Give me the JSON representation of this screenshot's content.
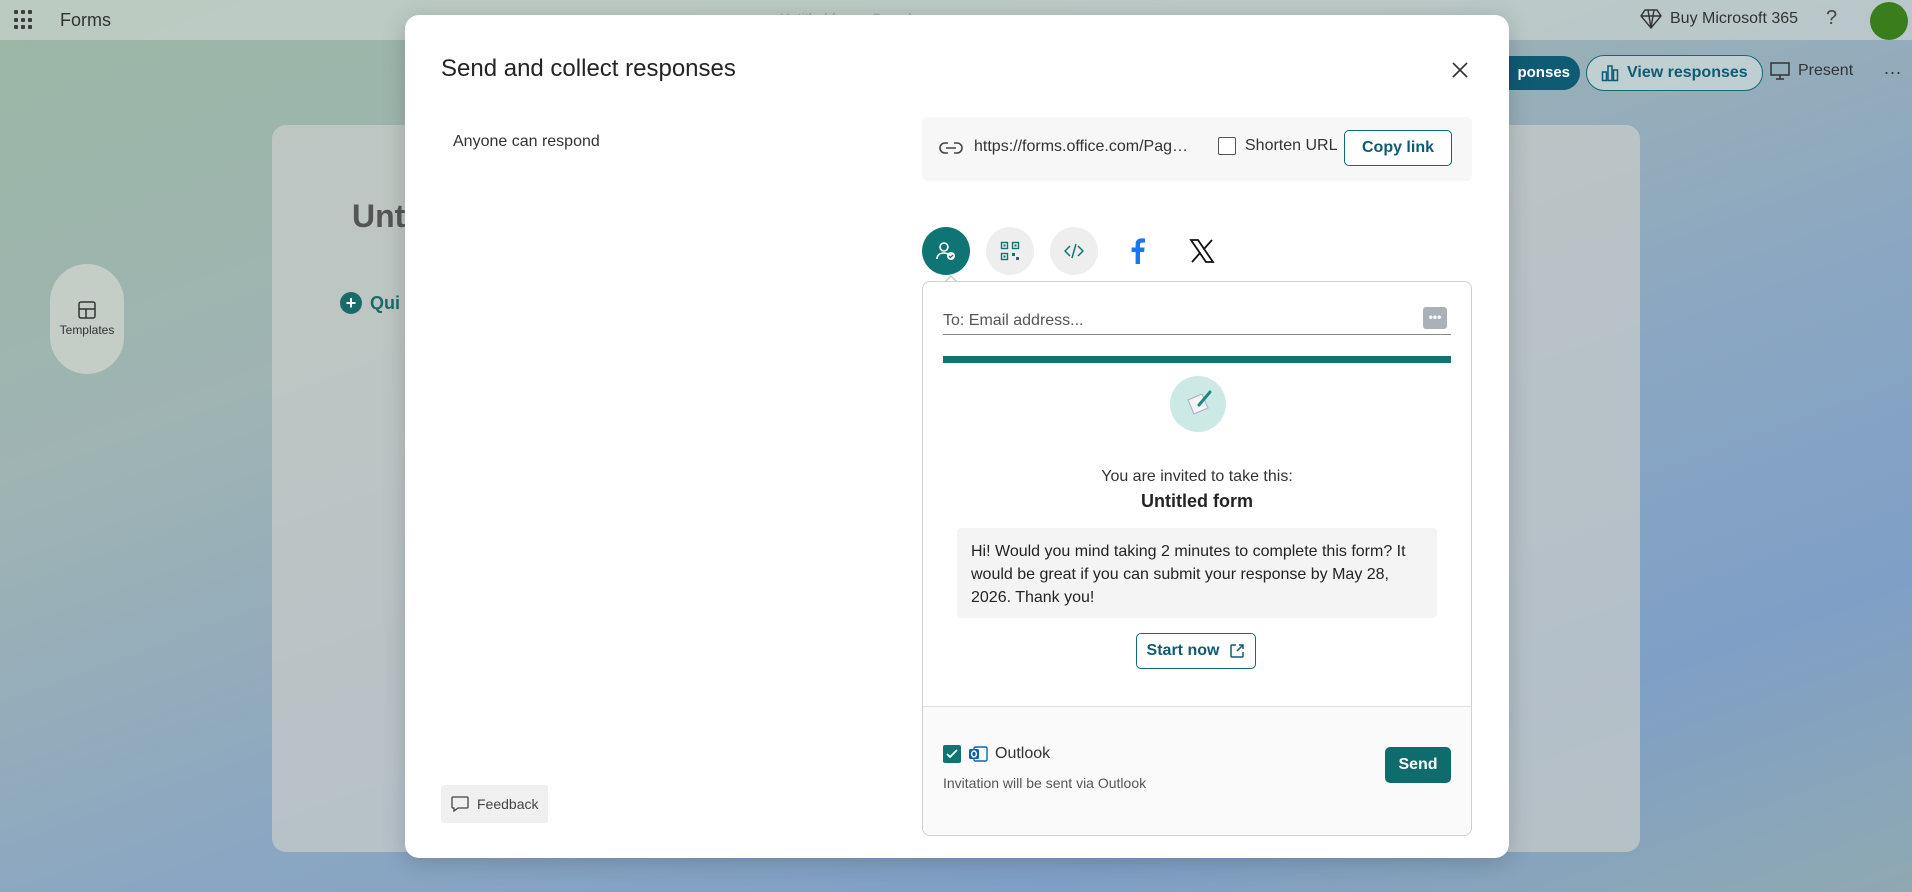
{
  "app": {
    "name": "Forms",
    "doc_title": "Untitled form - Saved",
    "buy_label": "Buy Microsoft 365",
    "help_label": "?"
  },
  "toolbar": {
    "collect_responses_label": "ponses",
    "view_responses_label": "View responses",
    "present_label": "Present",
    "more_label": "..."
  },
  "background": {
    "form_title_partial": "Unt",
    "quick_start_partial": "Qui",
    "templates_label": "Templates"
  },
  "modal": {
    "title": "Send and collect responses",
    "permission_label": "Anyone can respond",
    "link": {
      "url": "https://forms.office.com/Pages/ResponsePage.aspx",
      "shorten_label": "Shorten URL",
      "copy_label": "Copy link"
    },
    "share_options": [
      {
        "name": "invite-icon",
        "active": true
      },
      {
        "name": "qr-code-icon",
        "active": false
      },
      {
        "name": "embed-code-icon",
        "active": false
      },
      {
        "name": "facebook-icon",
        "active": false
      },
      {
        "name": "x-icon",
        "active": false
      }
    ],
    "email": {
      "placeholder": "To: Email address...",
      "more_label": "•••",
      "invited_text": "You are invited to take this:",
      "form_title": "Untitled form",
      "message": "Hi! Would you mind taking 2 minutes to complete this form? It would be great if you can submit your response by May 28, 2026. Thank you!",
      "start_label": "Start now",
      "outlook_label": "Outlook",
      "outlook_note": "Invitation will be sent via Outlook",
      "send_label": "Send"
    },
    "feedback_label": "Feedback"
  },
  "colors": {
    "accent": "#0f7574",
    "accent_dark": "#0f5b73"
  }
}
